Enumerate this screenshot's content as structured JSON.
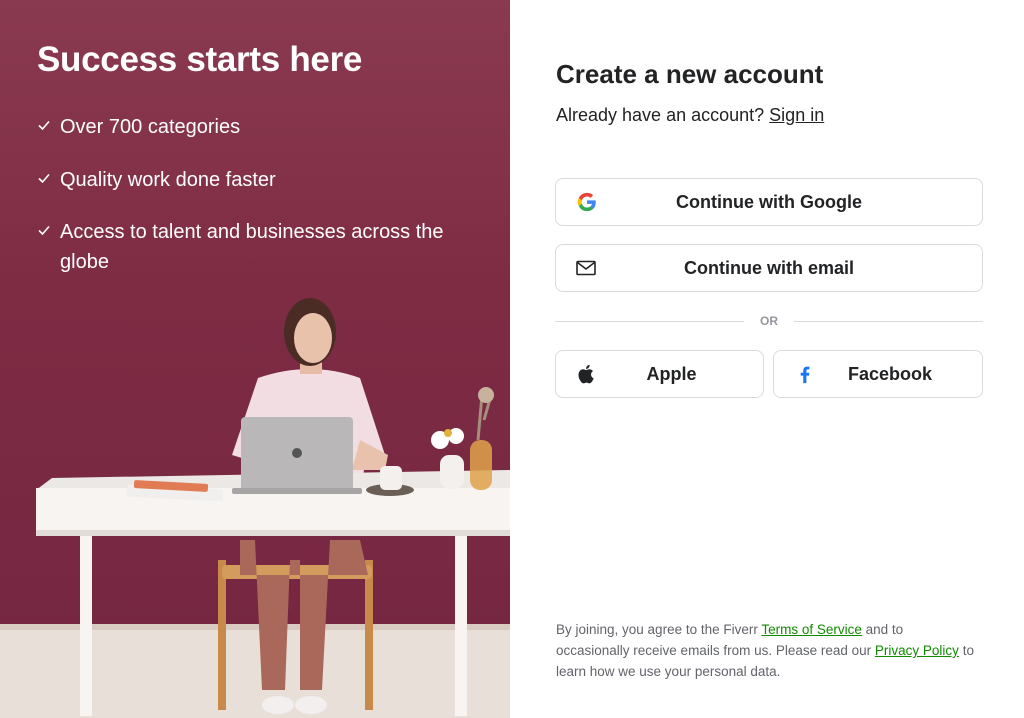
{
  "hero": {
    "title": "Success starts here",
    "benefits": [
      "Over 700 categories",
      "Quality work done faster",
      "Access to talent and businesses across the globe"
    ]
  },
  "form": {
    "title": "Create a new account",
    "signin_prompt": "Already have an account?",
    "signin_link": "Sign in",
    "google_label": "Continue with Google",
    "email_label": "Continue with email",
    "divider": "OR",
    "apple_label": "Apple",
    "facebook_label": "Facebook"
  },
  "legal": {
    "text_1": "By joining, you agree to the Fiverr ",
    "terms_link": "Terms of Service",
    "text_2": " and to occasionally receive emails from us. Please read our ",
    "privacy_link": "Privacy Policy",
    "text_3": " to learn how we use your personal data."
  },
  "colors": {
    "hero_bg": "#7e2c44",
    "link_green": "#108a00",
    "facebook_blue": "#1877f2"
  }
}
